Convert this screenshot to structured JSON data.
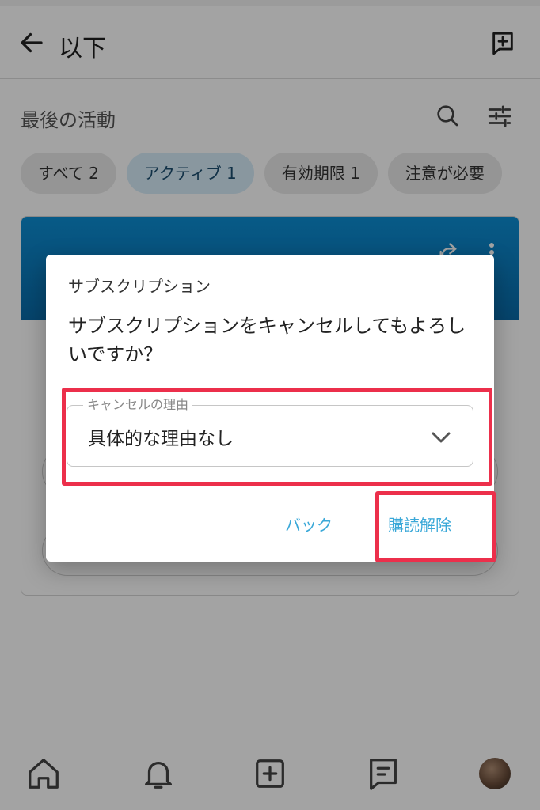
{
  "appbar": {
    "title": "以下",
    "back_icon": "arrow-left-icon",
    "new_icon": "new-message-icon"
  },
  "section": {
    "title": "最後の活動",
    "search_icon": "search-icon",
    "filter_icon": "sliders-icon"
  },
  "chips": [
    {
      "label": "すべて 2"
    },
    {
      "label": "アクティブ 1"
    },
    {
      "label": "有効期限 1"
    },
    {
      "label": "注意が必要"
    }
  ],
  "dialog": {
    "title": "サブスクリプション",
    "message": "サブスクリプションをキャンセルしてもよろしいですか？",
    "select": {
      "label": "キャンセルの理由",
      "value": "具体的な理由なし"
    },
    "back_label": "バック",
    "unsubscribe_label": "購読解除"
  },
  "bottom_nav": [
    "home-icon",
    "bell-icon",
    "add-square-icon",
    "chat-icon",
    "avatar"
  ],
  "colors": {
    "accent": "#3aa8d8",
    "highlight": "#ec2f4b",
    "active_chip": "#d7ecf9",
    "card_header": "#0b8ed4"
  }
}
